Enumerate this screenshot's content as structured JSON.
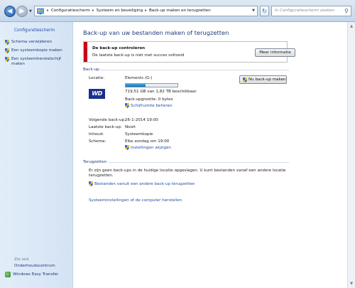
{
  "address": {
    "crumbs": [
      "Configuratiescherm",
      "Systeem en beveiliging",
      "Back-up maken en terugzetten"
    ],
    "search_placeholder": "In Configuratiescherm zoeken"
  },
  "sidebar": {
    "home": "Configuratiescherm",
    "items": [
      {
        "label": "Schema verwijderen"
      },
      {
        "label": "Een systeemkopie maken"
      },
      {
        "label": "Een systeemherstelschijf maken"
      }
    ],
    "see_also": "Zie ook",
    "bottom": [
      {
        "label": "Onderhoudscentrum"
      },
      {
        "label": "Windows Easy Transfer"
      }
    ]
  },
  "main": {
    "title": "Back-up van uw bestanden maken of terugzetten",
    "alert": {
      "title": "De back-up controleren",
      "subtitle": "De laatste back-up is niet met succes voltooid",
      "button": "Meer informatie"
    },
    "backup": {
      "section": "Back-up",
      "locatie_label": "Locatie:",
      "locatie_value": "Elements (G:)",
      "drive_fill": 0.39,
      "free_space": "719,51 GB van 1,82 TB beschikbaar",
      "backup_size": "Back-upgrootte: 0 bytes",
      "manage_link": "Schijfruimte beheren",
      "backup_now": "Nu back-up maken",
      "wd_logo": "WD",
      "next_label": "Volgende back-up:",
      "next_value": "26-1-2014 19:00",
      "last_label": "Laatste back-up:",
      "last_value": "Nooit",
      "content_label": "Inhoud:",
      "content_value": "Systeemkopie",
      "schedule_label": "Schema:",
      "schedule_value": "Elke zondag om 19:00",
      "change_link": "Instellingen wijzigen"
    },
    "restore": {
      "section": "Terugzetten",
      "text": "Er zijn geen back-ups in de huidige locatie opgeslagen. U kunt bestanden vanaf een andere locatie terugzetten.",
      "select_link": "Bestanden vanuit een andere back-up terugzetten",
      "recover_link": "Systeeminstellingen of de computer herstellen"
    }
  },
  "colors": {
    "accent": "#1e3a79",
    "link": "#1f4fa3",
    "alert": "#c8001a"
  }
}
